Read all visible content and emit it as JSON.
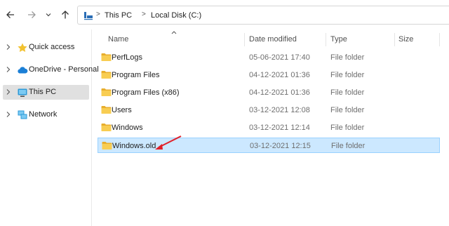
{
  "nav": {
    "back_icon": "arrow-left-icon",
    "forward_icon": "arrow-right-icon",
    "recent_icon": "chevron-down-icon",
    "up_icon": "arrow-up-icon"
  },
  "address": {
    "icon": "this-pc-icon",
    "crumbs": [
      "This PC",
      "Local Disk (C:)"
    ],
    "separator": ">"
  },
  "sidebar": {
    "items": [
      {
        "label": "Quick access",
        "icon": "star-icon",
        "selected": false
      },
      {
        "label": "OneDrive - Personal",
        "icon": "cloud-icon",
        "selected": false
      },
      {
        "label": "This PC",
        "icon": "monitor-icon",
        "selected": true
      },
      {
        "label": "Network",
        "icon": "network-icon",
        "selected": false
      }
    ]
  },
  "columns": {
    "name": "Name",
    "date": "Date modified",
    "type": "Type",
    "size": "Size"
  },
  "files": [
    {
      "name": "PerfLogs",
      "date": "05-06-2021 17:40",
      "type": "File folder",
      "selected": false
    },
    {
      "name": "Program Files",
      "date": "04-12-2021 01:36",
      "type": "File folder",
      "selected": false
    },
    {
      "name": "Program Files (x86)",
      "date": "04-12-2021 01:36",
      "type": "File folder",
      "selected": false
    },
    {
      "name": "Users",
      "date": "03-12-2021 12:08",
      "type": "File folder",
      "selected": false
    },
    {
      "name": "Windows",
      "date": "03-12-2021 12:14",
      "type": "File folder",
      "selected": false
    },
    {
      "name": "Windows.old",
      "date": "03-12-2021 12:15",
      "type": "File folder",
      "selected": true
    }
  ],
  "colors": {
    "folder": "#f5c84a",
    "selection_bg": "#cce8ff",
    "selection_border": "#99d1ff",
    "annotation": "#e0202a"
  }
}
